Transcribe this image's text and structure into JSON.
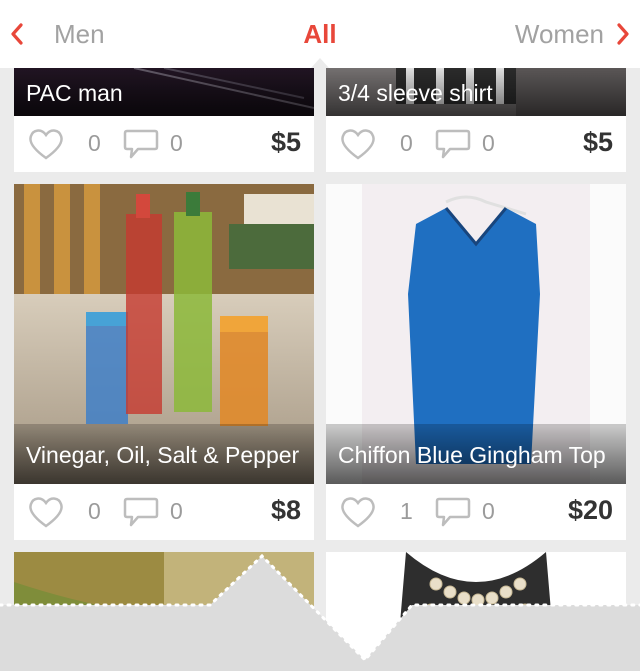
{
  "header": {
    "left_tab": "Men",
    "center_tab": "All",
    "right_tab": "Women"
  },
  "colors": {
    "accent": "#e8473a",
    "inactive": "#a2a2a2",
    "background": "#ebebeb"
  },
  "items": [
    {
      "title": "PAC man",
      "likes": "0",
      "comments": "0",
      "price": "$5"
    },
    {
      "title": "3/4 sleeve shirt",
      "likes": "0",
      "comments": "0",
      "price": "$5"
    },
    {
      "title": "Vinegar, Oil, Salt & Pepper",
      "likes": "0",
      "comments": "0",
      "price": "$8"
    },
    {
      "title": "Chiffon Blue Gingham Top",
      "likes": "1",
      "comments": "0",
      "price": "$20"
    }
  ]
}
